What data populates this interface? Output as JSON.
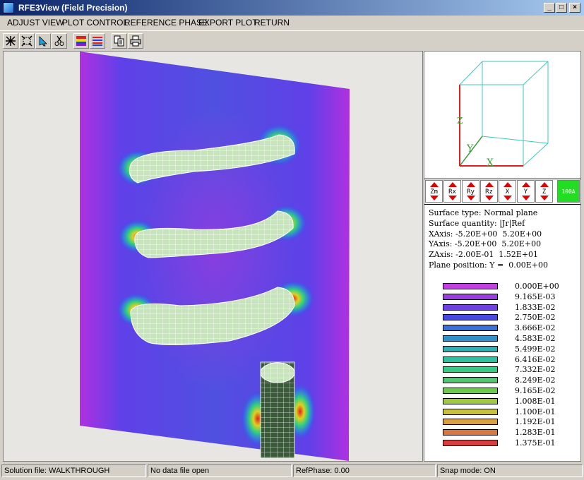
{
  "window": {
    "title": "RFE3View (Field Precision)",
    "controls": [
      "_",
      "□",
      "×"
    ]
  },
  "menu": [
    "ADJUST VIEW",
    "PLOT CONTROL",
    "REFERENCE PHASE",
    "EXPORT PLOT",
    "RETURN"
  ],
  "toolbar": [
    "zoom-window-icon",
    "full-view-icon",
    "pointer-icon",
    "cut-icon",
    "color-plot-icon",
    "contour-plot-icon",
    "copy-icon",
    "print-icon"
  ],
  "axes_widget": {
    "x_label": "X",
    "y_label": "Y",
    "z_label": "Z"
  },
  "view_buttons": [
    "Zm",
    "Rx",
    "Ry",
    "Rz",
    "X",
    "Y",
    "Z"
  ],
  "scale_button": "100A",
  "info": {
    "surface_type": "Surface type: Normal plane",
    "surface_quantity": "Surface quantity: |Jr|Ref",
    "xaxis": "XAxis: -5.20E+00  5.20E+00",
    "yaxis": "YAxis: -5.20E+00  5.20E+00",
    "zaxis": "ZAxis: -2.00E-01  1.52E+01",
    "plane_position": "Plane position: Y =  0.00E+00"
  },
  "legend": [
    {
      "value": "0.000E+00",
      "color": "#c040e0"
    },
    {
      "value": "9.165E-03",
      "color": "#9a3ee0"
    },
    {
      "value": "1.833E-02",
      "color": "#7040e0"
    },
    {
      "value": "2.750E-02",
      "color": "#4848e0"
    },
    {
      "value": "3.666E-02",
      "color": "#3a70d8"
    },
    {
      "value": "4.583E-02",
      "color": "#3090c8"
    },
    {
      "value": "5.499E-02",
      "color": "#30b0b8"
    },
    {
      "value": "6.416E-02",
      "color": "#30c0a0"
    },
    {
      "value": "7.332E-02",
      "color": "#38c888"
    },
    {
      "value": "8.249E-02",
      "color": "#50c870"
    },
    {
      "value": "9.165E-02",
      "color": "#70c850"
    },
    {
      "value": "1.008E-01",
      "color": "#a0c840"
    },
    {
      "value": "1.100E-01",
      "color": "#c8c040"
    },
    {
      "value": "1.192E-01",
      "color": "#d8a040"
    },
    {
      "value": "1.283E-01",
      "color": "#d87840"
    },
    {
      "value": "1.375E-01",
      "color": "#d84040"
    }
  ],
  "status": {
    "solution_file": "Solution file: WALKTHROUGH",
    "data_file": "No data file open",
    "refphase": "RefPhase:    0.00",
    "snap_mode": "Snap mode: ON"
  }
}
